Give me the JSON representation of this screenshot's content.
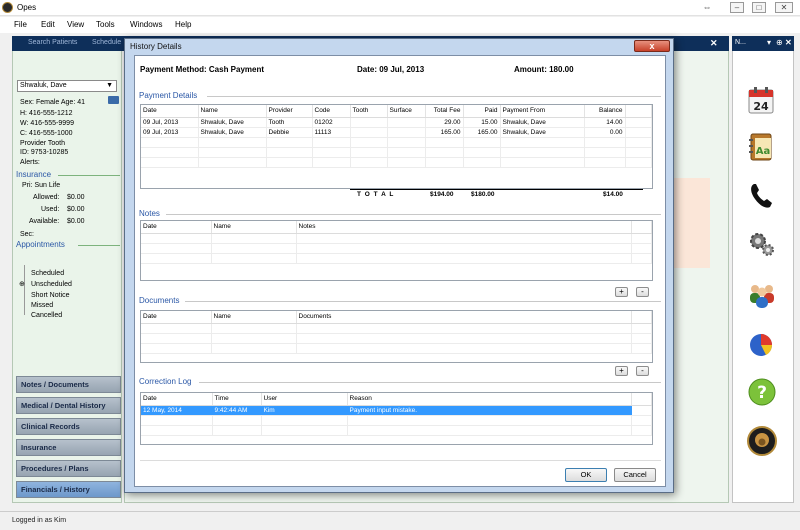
{
  "app": {
    "title": "Opes"
  },
  "menu": [
    "File",
    "Edit",
    "View",
    "Tools",
    "Windows",
    "Help"
  ],
  "tabs": [
    "Search Patients",
    "Schedule"
  ],
  "patient": {
    "name": "Shwaluk, Dave",
    "sex_label": "Sex:",
    "sex": "Female",
    "age_label": "Age:",
    "age": "41",
    "h": "H: 416-555-1212",
    "w": "W: 416-555-9999",
    "c": "C: 416-555-1000",
    "provider": "Provider Tooth",
    "id": "ID:  9753-10285",
    "alerts": "Alerts:"
  },
  "insurance": {
    "title": "Insurance",
    "pri": "Pri:  Sun Life",
    "allowed_label": "Allowed:",
    "allowed": "$0.00",
    "used_label": "Used:",
    "used": "$0.00",
    "available_label": "Available:",
    "available": "$0.00",
    "sec": "Sec:"
  },
  "appointments": {
    "title": "Appointments",
    "items": [
      "Scheduled",
      "Unscheduled",
      "Short Notice",
      "Missed",
      "Cancelled"
    ]
  },
  "nav": [
    "Notes / Documents",
    "Medical / Dental History",
    "Clinical Records",
    "Insurance",
    "Procedures / Plans",
    "Financials / History"
  ],
  "right_panel": {
    "header": "N..."
  },
  "status": "Logged in as Kim",
  "dialog": {
    "title": "History Details",
    "close": "x",
    "header": {
      "method": "Payment Method: Cash Payment",
      "date": "Date: 09 Jul, 2013",
      "amount": "Amount: 180.00"
    },
    "payment_details": {
      "title": "Payment Details",
      "columns": [
        "Date",
        "Name",
        "Provider",
        "Code",
        "Tooth",
        "Surface",
        "Total Fee",
        "Paid",
        "Payment From",
        "Balance"
      ],
      "rows": [
        [
          "09 Jul, 2013",
          "Shwaluk, Dave",
          "Tooth",
          "01202",
          "",
          "",
          "29.00",
          "15.00",
          "Shwaluk, Dave",
          "14.00"
        ],
        [
          "09 Jul, 2013",
          "Shwaluk, Dave",
          "Debbie",
          "11113",
          "",
          "",
          "165.00",
          "165.00",
          "Shwaluk, Dave",
          "0.00"
        ]
      ],
      "totals": {
        "label": "T O T A L",
        "fee": "$194.00",
        "paid": "$180.00",
        "balance": "$14.00"
      }
    },
    "notes": {
      "title": "Notes",
      "columns": [
        "Date",
        "Name",
        "Notes"
      ]
    },
    "documents": {
      "title": "Documents",
      "columns": [
        "Date",
        "Name",
        "Documents"
      ]
    },
    "correction_log": {
      "title": "Correction Log",
      "columns": [
        "Date",
        "Time",
        "User",
        "Reason"
      ],
      "rows": [
        [
          "12 May, 2014",
          "9:42:44 AM",
          "Kim",
          "Payment input mistake."
        ]
      ]
    },
    "add": "+",
    "remove": "-",
    "ok": "OK",
    "cancel": "Cancel"
  },
  "colors": {
    "nav_header": "#0e2f5a",
    "panel_bg": "#eaf4ea",
    "selection": "#3399ff",
    "group_title": "#2a57a6"
  }
}
